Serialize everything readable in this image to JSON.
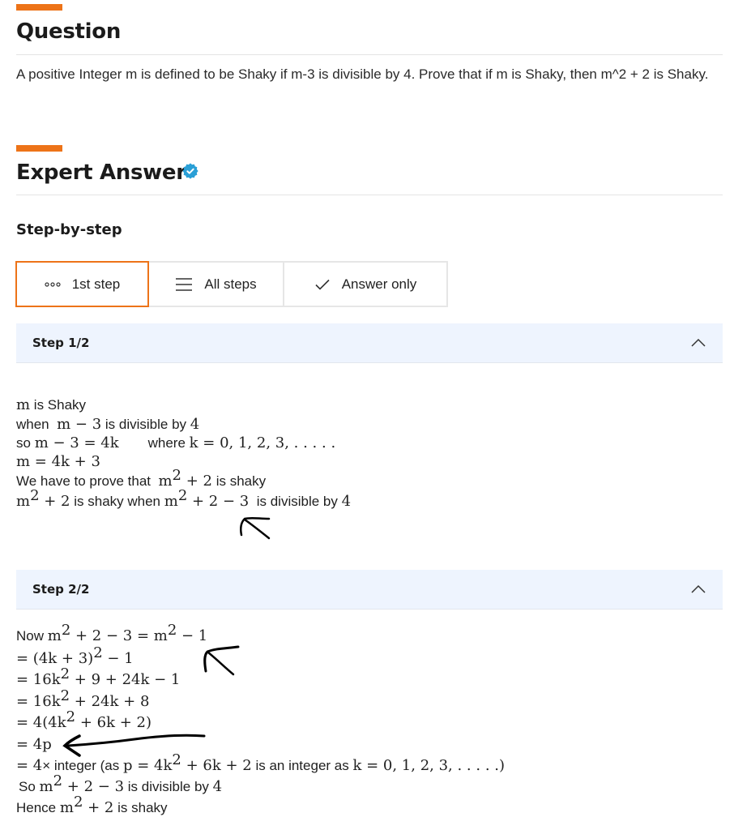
{
  "question": {
    "heading": "Question",
    "text": "A positive Integer m is defined to be Shaky if m-3 is divisible by 4. Prove that if m is Shaky, then m^2 + 2 is Shaky."
  },
  "answer": {
    "heading": "Expert Answer",
    "verified_icon": "verified-badge-icon",
    "subheading": "Step-by-step"
  },
  "tabs": [
    {
      "label": "1st step",
      "icon": "dots-icon",
      "active": true
    },
    {
      "label": "All steps",
      "icon": "list-icon",
      "active": false
    },
    {
      "label": "Answer only",
      "icon": "check-icon",
      "active": false
    }
  ],
  "steps": [
    {
      "title": "Step 1/2",
      "lines": {
        "l1": {
          "m": "m",
          "t": " is Shaky"
        },
        "l2": {
          "t1": "when ",
          "m": "m − 3",
          "t2": " is divisible by ",
          "m2": "4"
        },
        "l3": {
          "t1": "so ",
          "m": "m − 3 = 4k",
          "t2": "where ",
          "m2": "k = 0, 1, 2, 3, . . . . ."
        },
        "l4": {
          "m": "m = 4k + 3"
        },
        "l5": {
          "t1": "We have to prove that ",
          "m_base": "m",
          "sup": "2",
          "m_rest": " + 2",
          "t2": " is shaky"
        },
        "l6": {
          "m_base": "m",
          "sup": "2",
          "m_rest": " + 2",
          "t1": " is shaky when ",
          "m2_base": "m",
          "sup2": "2",
          "m2_rest": " + 2 − 3",
          "t2": " is divisible by ",
          "m3": "4"
        }
      }
    },
    {
      "title": "Step 2/2",
      "lines": {
        "l1": {
          "t1": "Now ",
          "a": "m",
          "s1": "2",
          "b": " + 2 − 3 = m",
          "s2": "2",
          "c": " − 1"
        },
        "l2": {
          "a": "= (4k + 3)",
          "s1": "2",
          "b": " − 1"
        },
        "l3": {
          "a": "= 16k",
          "s1": "2",
          "b": " + 9 + 24k − 1"
        },
        "l4": {
          "a": "= 16k",
          "s1": "2",
          "b": " + 24k + 8"
        },
        "l5": {
          "a": "= 4(4k",
          "s1": "2",
          "b": " + 6k + 2)"
        },
        "l6": {
          "a": "= 4p"
        },
        "l7": {
          "a": "= 4",
          "x": "×",
          "t1": " integer  (as ",
          "b": "p = 4k",
          "s1": "2",
          "c": " + 6k + 2",
          "t2": " is an integer as ",
          "d": "k = 0, 1, 2, 3, . . . . .)"
        },
        "l8": {
          "t1": "So ",
          "a": "m",
          "s1": "2",
          "b": " + 2 − 3",
          "t2": "  is divisible by ",
          "c": "4"
        },
        "l9": {
          "t1": "Hence ",
          "a": "m",
          "s1": "2",
          "b": " + 2",
          "t2": " is shaky"
        }
      }
    }
  ],
  "colors": {
    "accent": "#ed7318",
    "verified": "#2a9fd6",
    "step_header_bg": "#eef4fe"
  }
}
